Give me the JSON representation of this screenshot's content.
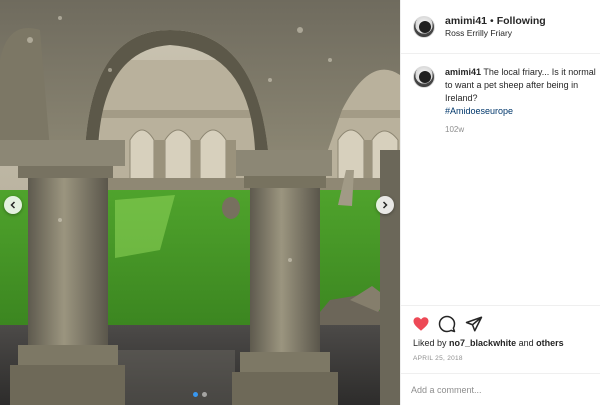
{
  "post": {
    "username": "amimi41",
    "separator": "•",
    "follow_label": "Following",
    "location": "Ross Errilly Friary",
    "caption_text": "The local friary... Is it normal to want a pet sheep after being in Ireland?",
    "hashtag": "#Amidoeseurope",
    "time_ago": "102w",
    "likes_prefix": "Liked by",
    "likes_user": "no7_blackwhite",
    "likes_and": "and",
    "likes_others": "others",
    "date": "APRIL 25, 2018",
    "comment_placeholder": "Add a comment..."
  },
  "carousel": {
    "dots": 2,
    "active": 0
  },
  "colors": {
    "like": "#ed4956",
    "hashtag": "#00376b",
    "active_dot": "#3897f0"
  },
  "icons": {
    "heart": "heart-icon",
    "comment": "comment-icon",
    "share": "share-icon",
    "prev": "chevron-left-icon",
    "next": "chevron-right-icon"
  }
}
